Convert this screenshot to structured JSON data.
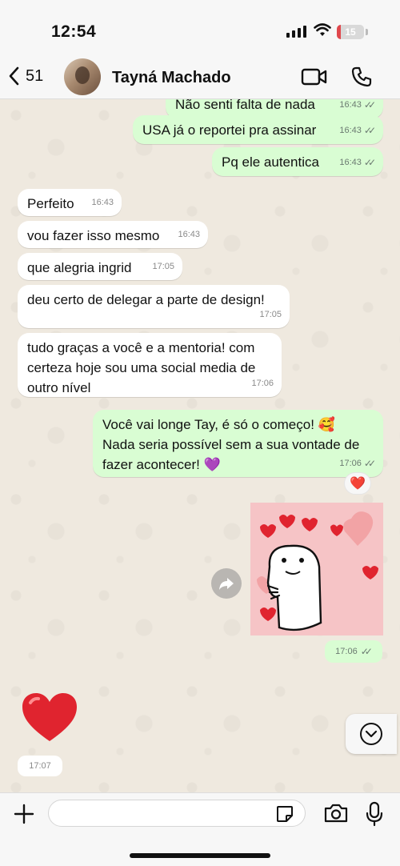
{
  "status_bar": {
    "time": "12:54",
    "battery": "15",
    "battery_level": 0.15
  },
  "header": {
    "back_count": "51",
    "contact_name": "Tayná Machado"
  },
  "messages": [
    {
      "text": "Não senti falta de nada",
      "time": "16:43"
    },
    {
      "text": "USA já o reportei pra assinar",
      "time": "16:43"
    },
    {
      "text": "Pq ele autentica",
      "time": "16:43"
    },
    {
      "text": "Perfeito",
      "time": "16:43"
    },
    {
      "text": "vou fazer isso mesmo",
      "time": "16:43"
    },
    {
      "text": "que alegria ingrid",
      "time": "17:05"
    },
    {
      "text": "deu certo de delegar a parte de design!",
      "time": "17:05"
    },
    {
      "text": "tudo graças a você e a mentoria! com certeza hoje sou uma social media de outro nível",
      "time": "17:06"
    },
    {
      "text": "Você vai longe Tay, é só o começo! 🥰 Nada seria possível sem a sua vontade de fazer acontecer! 💜",
      "time": "17:06"
    },
    {
      "text": "❤️",
      "time": "17:06"
    },
    {
      "text": "❤️",
      "time": "17:07"
    }
  ],
  "reaction": "❤️",
  "colors": {
    "outgoing": "#d9fdd3",
    "incoming": "#ffffff",
    "heart": "#e0242f"
  },
  "icons": [
    "back-chevron-icon",
    "video-call-icon",
    "phone-icon",
    "forward-icon",
    "chevron-down-icon",
    "plus-icon",
    "sticker-icon",
    "camera-icon",
    "mic-icon"
  ]
}
